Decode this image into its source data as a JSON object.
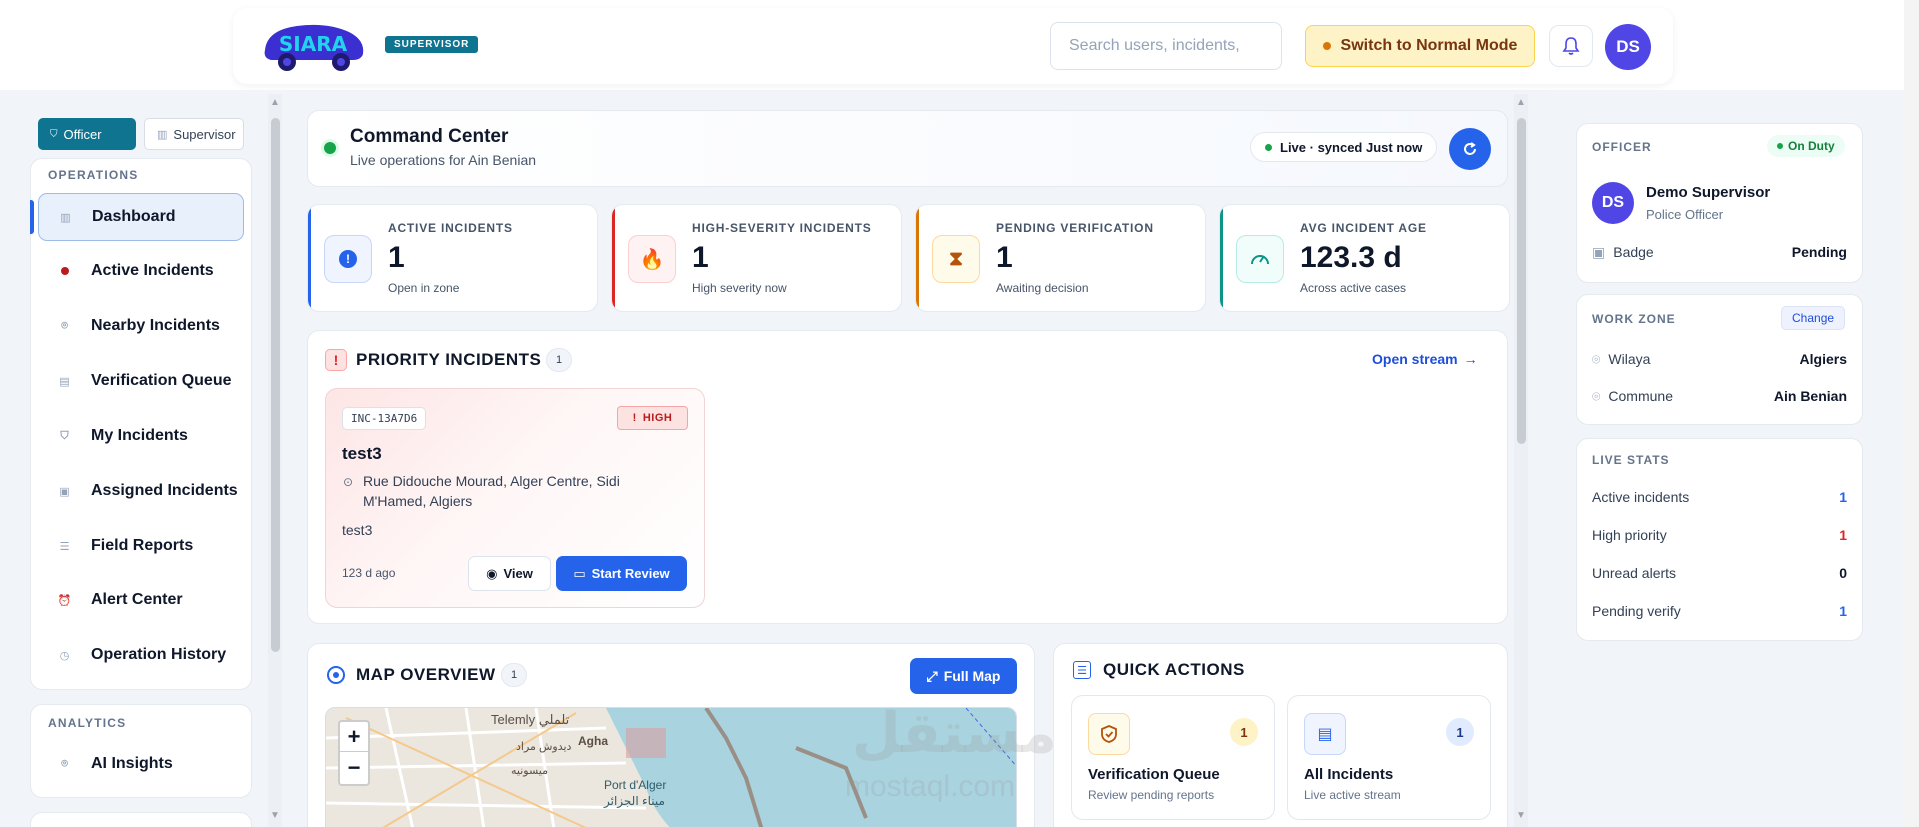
{
  "header": {
    "logo_text": "SIARA",
    "role_badge": "SUPERVISOR",
    "search_placeholder": "Search users, incidents,",
    "switch_mode_label": "Switch to Normal Mode",
    "avatar_initials": "DS"
  },
  "sidebar": {
    "mode_officer": "Officer",
    "mode_supervisor": "Supervisor",
    "section_operations": "OPERATIONS",
    "items": [
      {
        "label": "Dashboard",
        "icon": "building-icon",
        "active": true
      },
      {
        "label": "Active Incidents",
        "icon": "dot-icon"
      },
      {
        "label": "Nearby Incidents",
        "icon": "pin-icon"
      },
      {
        "label": "Verification Queue",
        "icon": "clipboard-icon"
      },
      {
        "label": "My Incidents",
        "icon": "shield-icon"
      },
      {
        "label": "Assigned Incidents",
        "icon": "badge-icon"
      },
      {
        "label": "Field Reports",
        "icon": "list-icon"
      },
      {
        "label": "Alert Center",
        "icon": "alarm-icon"
      },
      {
        "label": "Operation History",
        "icon": "history-icon"
      }
    ],
    "section_analytics": "ANALYTICS",
    "analytics_items": [
      {
        "label": "AI Insights",
        "icon": "pin-icon"
      }
    ]
  },
  "command_center": {
    "title": "Command Center",
    "subtitle": "Live operations for Ain Benian",
    "live_status": "Live · synced Just now"
  },
  "stats": [
    {
      "label": "ACTIVE INCIDENTS",
      "value": "1",
      "desc": "Open in zone",
      "color": "#2563eb",
      "icon": "alert-circle-icon"
    },
    {
      "label": "HIGH-SEVERITY INCIDENTS",
      "value": "1",
      "desc": "High severity now",
      "color": "#dc2626",
      "icon": "flame-icon"
    },
    {
      "label": "PENDING VERIFICATION",
      "value": "1",
      "desc": "Awaiting decision",
      "color": "#d97706",
      "icon": "hourglass-icon"
    },
    {
      "label": "AVG INCIDENT AGE",
      "value": "123.3 d",
      "desc": "Across active cases",
      "color": "#0d9488",
      "icon": "gauge-icon"
    }
  ],
  "priority": {
    "title": "PRIORITY INCIDENTS",
    "count": "1",
    "open_stream": "Open stream",
    "incident": {
      "id": "INC-13A7D6",
      "severity": "HIGH",
      "title": "test3",
      "address_line1": "Rue Didouche Mourad, Alger Centre, Sidi",
      "address_line2": "M'Hamed, Algiers",
      "description": "test3",
      "age": "123 d ago",
      "view_label": "View",
      "start_review_label": "Start Review"
    }
  },
  "map": {
    "title": "MAP OVERVIEW",
    "count": "1",
    "full_map_label": "Full Map",
    "zoom_in": "+",
    "zoom_out": "−",
    "place_labels": [
      "Telemly تلملي",
      "Agha",
      "Port d'Alger",
      "ميناء الجزائر",
      "ديدوش مراد",
      "ميسونيه"
    ]
  },
  "quick_actions": {
    "title": "QUICK ACTIONS",
    "items": [
      {
        "title": "Verification Queue",
        "desc": "Review pending reports",
        "count": "1",
        "icon": "shield-check-icon"
      },
      {
        "title": "All Incidents",
        "desc": "Live active stream",
        "count": "1",
        "icon": "list-icon"
      }
    ]
  },
  "officer": {
    "label": "OFFICER",
    "status": "On Duty",
    "initials": "DS",
    "name": "Demo Supervisor",
    "role": "Police Officer",
    "badge_label": "Badge",
    "badge_value": "Pending"
  },
  "work_zone": {
    "label": "WORK ZONE",
    "change_label": "Change",
    "wilaya_label": "Wilaya",
    "wilaya_value": "Algiers",
    "commune_label": "Commune",
    "commune_value": "Ain Benian"
  },
  "live_stats": {
    "label": "LIVE STATS",
    "rows": [
      {
        "label": "Active incidents",
        "value": "1",
        "color": "#2563eb"
      },
      {
        "label": "High priority",
        "value": "1",
        "color": "#dc2626"
      },
      {
        "label": "Unread alerts",
        "value": "0",
        "color": "#0f172a"
      },
      {
        "label": "Pending verify",
        "value": "1",
        "color": "#2563eb"
      }
    ]
  },
  "watermark": {
    "text": "مستقل",
    "sub": "mostaql.com"
  }
}
